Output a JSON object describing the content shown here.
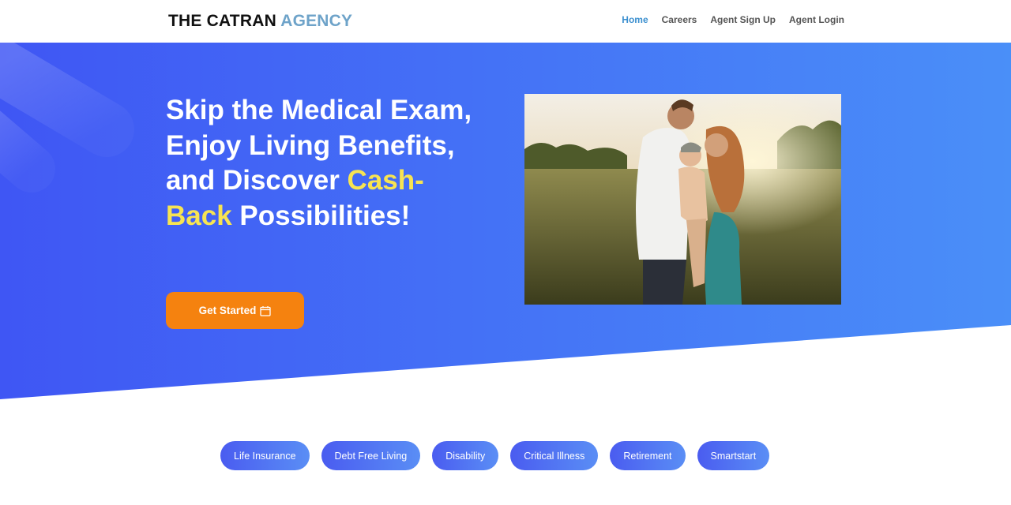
{
  "header": {
    "logo_main": "THE CATRAN",
    "logo_accent": "AGENCY",
    "nav": [
      "Home",
      "Careers",
      "Agent Sign Up",
      "Agent Login"
    ]
  },
  "hero": {
    "headline_part1": "Skip the Medical Exam, Enjoy Living Benefits, and Discover",
    "headline_highlight": "Cash-Back",
    "headline_part2": "Possibilities!",
    "cta_label": "Get Started",
    "cta_icon": "calendar-icon",
    "photo_icon": "family-photo"
  },
  "pills": [
    "Life Insurance",
    "Debt Free Living",
    "Disability",
    "Critical Illness",
    "Retirement",
    "Smartstart"
  ],
  "colors": {
    "hero_start": "#3f56f4",
    "hero_end": "#4a8ff8",
    "cta": "#f5820f",
    "highlight": "#f7e452",
    "nav_active": "#3b8fcf",
    "logo_accent": "#6ea3c9"
  }
}
